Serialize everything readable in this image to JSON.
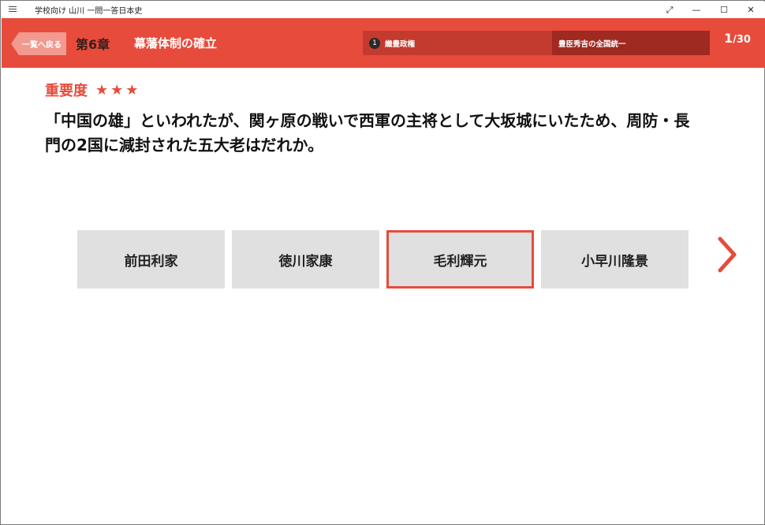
{
  "window": {
    "title": "学校向け 山川 一問一答日本史",
    "icons": {
      "menu": "hamburger-icon",
      "expand": "expand-icon",
      "minimize": "minimize-icon",
      "maximize": "maximize-icon",
      "close": "close-icon"
    }
  },
  "header": {
    "back_label": "一覧へ戻る",
    "chapter_number": "第6章",
    "chapter_title": "幕藩体制の確立",
    "section_index": "1",
    "section_label": "織豊政権",
    "subsection_label": "豊臣秀吉の全国統一",
    "counter_current": "1",
    "counter_sep": "/",
    "counter_total": "30",
    "colors": {
      "accent": "#e74b3c",
      "section": "#c33b2e",
      "subsection": "#9e2a21"
    }
  },
  "question": {
    "importance_label": "重要度",
    "importance_stars": "★★★",
    "importance_level": 3,
    "text": "「中国の雄」といわれたが、関ヶ原の戦いで西軍の主将として大坂城にいたため、周防・長門の2国に減封された五大老はだれか。"
  },
  "choices": [
    {
      "label": "前田利家",
      "selected": false
    },
    {
      "label": "徳川家康",
      "selected": false
    },
    {
      "label": "毛利輝元",
      "selected": true
    },
    {
      "label": "小早川隆景",
      "selected": false
    }
  ],
  "navigation": {
    "next_icon": "chevron-right-icon"
  }
}
